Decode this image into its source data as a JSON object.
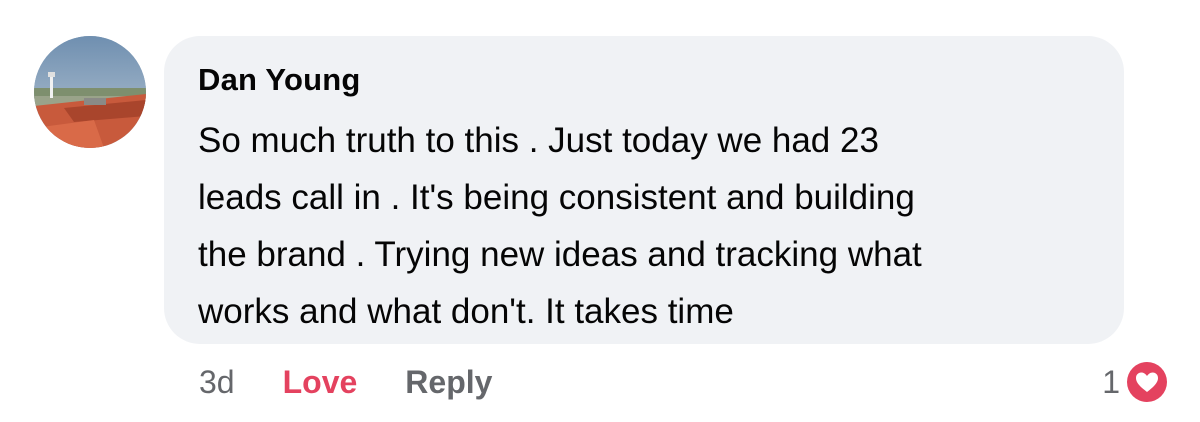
{
  "comment": {
    "author": "Dan Young",
    "text": "So much truth to this . Just today we had 23\nleads call in . It's being consistent and building\nthe brand . Trying new ideas and tracking what\nworks and what don't.  It takes time",
    "timestamp": "3d",
    "actions": {
      "love_label": "Love",
      "reply_label": "Reply"
    },
    "reactions": {
      "count": "1",
      "icon": "love-reaction-icon"
    }
  },
  "colors": {
    "bubble": "#f0f2f5",
    "love": "#e4425f",
    "secondary_text": "#65676b",
    "primary_text": "#050505"
  }
}
